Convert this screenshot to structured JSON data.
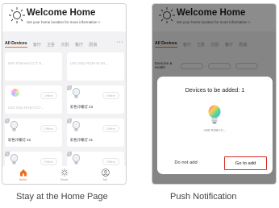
{
  "screens": {
    "home": {
      "header": {
        "title": "Welcome Home",
        "subtitle": "Set your home location for more information >"
      },
      "tabs": [
        "All Devices",
        "客厅",
        "主卧",
        "次卧",
        "餐厅",
        "厨房"
      ],
      "more_label": "···",
      "devices": [
        {
          "name": "WiFi Filament CCT &...",
          "status": ""
        },
        {
          "name": "LED Strip RGB+W WL...",
          "status": ""
        },
        {
          "name": "LED Strip RGB+CCT...",
          "status": "Offline"
        },
        {
          "name": "彩色冷暖灯 23",
          "status": "Offline",
          "badge": "1"
        },
        {
          "name": "彩色冷暖灯 22",
          "status": "Offline",
          "badge": "1"
        },
        {
          "name": "彩色冷暖灯 21",
          "status": "Offline",
          "badge": "1"
        },
        {
          "name": "",
          "status": "Offline",
          "badge": "1"
        },
        {
          "name": "",
          "status": "Offline",
          "badge": "1"
        }
      ],
      "nav": [
        {
          "label": "Home",
          "icon": "house-icon"
        },
        {
          "label": "Smart",
          "icon": "sun-icon"
        },
        {
          "label": "Me",
          "icon": "person-icon"
        }
      ]
    },
    "notification": {
      "header": {
        "title": "Welcome Home",
        "subtitle": "Set your home location for more information >"
      },
      "tabs": [
        "All Devices",
        "客厅",
        "主卧",
        "次卧",
        "餐厅",
        "厨房"
      ],
      "section_label": "Exercise & Health",
      "dialog": {
        "title": "Devices to be added: 1",
        "device_name": "A60 RGB+C...",
        "cancel_label": "Do not add",
        "confirm_label": "Go to add"
      }
    }
  },
  "captions": {
    "left": "Stay at the Home Page",
    "right": "Push Notification"
  },
  "colors": {
    "accent": "#f06a1c",
    "highlight_border": "#d8312a"
  }
}
